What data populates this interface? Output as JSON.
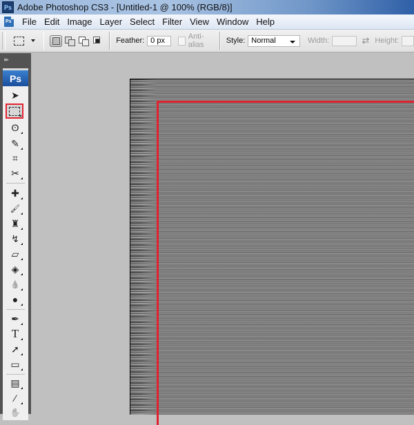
{
  "window": {
    "title": "Adobe Photoshop CS3 - [Untitled-1 @ 100% (RGB/8)]",
    "app_badge": "Ps"
  },
  "menubar": {
    "items": [
      "File",
      "Edit",
      "Image",
      "Layer",
      "Select",
      "Filter",
      "View",
      "Window",
      "Help"
    ]
  },
  "options": {
    "tool_preset_icon": "rectangular-marquee-icon",
    "selection_modes": [
      "new-selection",
      "add-to-selection",
      "subtract-from-selection",
      "intersect-with-selection"
    ],
    "active_mode": "new-selection",
    "feather_label": "Feather:",
    "feather_value": "0 px",
    "antialias_label": "Anti-alias",
    "antialias_checked": false,
    "style_label": "Style:",
    "style_value": "Normal",
    "width_label": "Width:",
    "width_value": "",
    "height_label": "Height:",
    "height_value": ""
  },
  "tools_panel": {
    "collapse_glyph": "▸▸",
    "badge": "Ps",
    "selected_tool": "rectangular-marquee",
    "tools": [
      {
        "name": "move-tool",
        "glyph": "➤"
      },
      {
        "name": "rectangular-marquee-tool",
        "glyph": "⬚"
      },
      {
        "name": "lasso-tool",
        "glyph": "ʘ"
      },
      {
        "name": "quick-selection-tool",
        "glyph": "✎"
      },
      {
        "name": "crop-tool",
        "glyph": "⌗"
      },
      {
        "name": "slice-tool",
        "glyph": "✂"
      },
      {
        "name": "spot-healing-brush-tool",
        "glyph": "✚"
      },
      {
        "name": "brush-tool",
        "glyph": "🖌"
      },
      {
        "name": "clone-stamp-tool",
        "glyph": "♜"
      },
      {
        "name": "history-brush-tool",
        "glyph": "↯"
      },
      {
        "name": "eraser-tool",
        "glyph": "▱"
      },
      {
        "name": "paint-bucket-tool",
        "glyph": "◈"
      },
      {
        "name": "blur-tool",
        "glyph": "💧"
      },
      {
        "name": "dodge-tool",
        "glyph": "●"
      },
      {
        "name": "pen-tool",
        "glyph": "✒"
      },
      {
        "name": "type-tool",
        "glyph": "T"
      },
      {
        "name": "path-selection-tool",
        "glyph": "➚"
      },
      {
        "name": "rectangle-shape-tool",
        "glyph": "▭"
      },
      {
        "name": "notes-tool",
        "glyph": "▤"
      },
      {
        "name": "eyedropper-tool",
        "glyph": "⁄"
      },
      {
        "name": "hand-tool",
        "glyph": "✋"
      }
    ]
  },
  "document": {
    "name": "Untitled-1",
    "zoom": "100%",
    "mode": "RGB/8",
    "highlight_color": "#e0222e"
  }
}
